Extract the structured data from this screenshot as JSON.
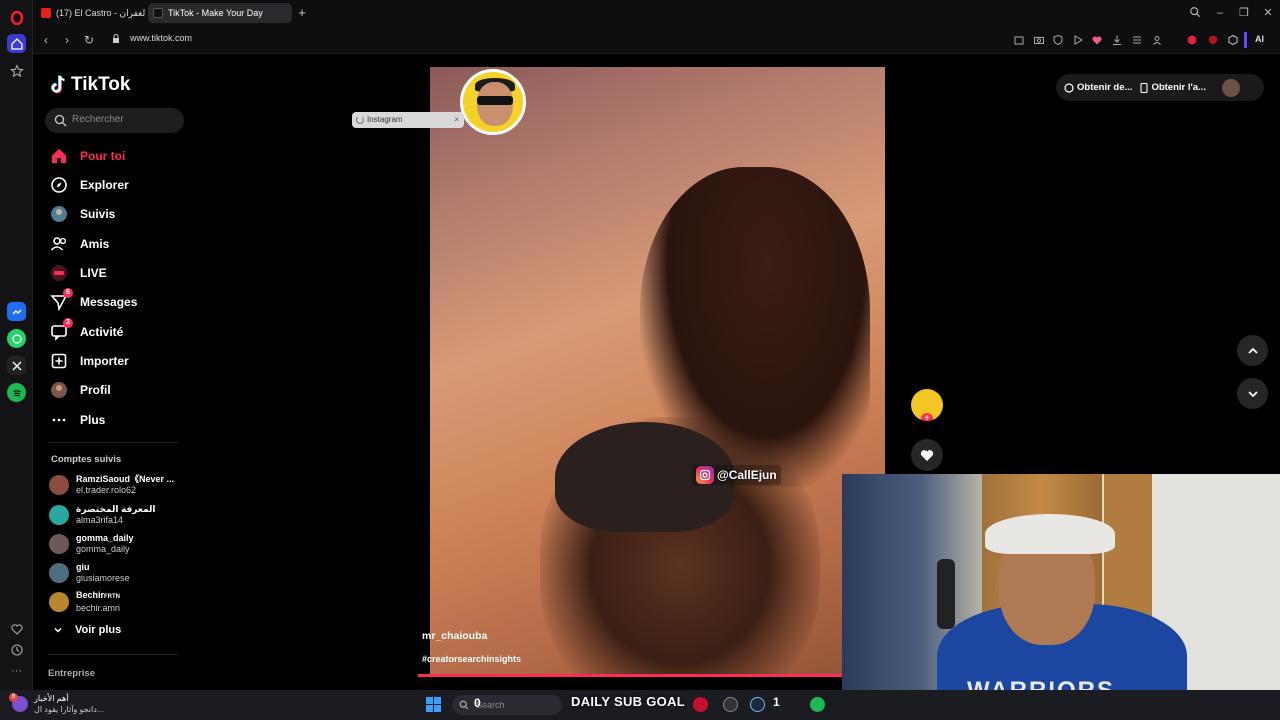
{
  "browser": {
    "tabs": [
      {
        "label": "(17) El Castro - الة الغفران",
        "active": false
      },
      {
        "label": "TikTok - Make Your Day",
        "active": true
      }
    ],
    "url": "www.tiktok.com",
    "ai_label": "AI"
  },
  "tiktok": {
    "logo": "TikTok",
    "search_placeholder": "Rechercher",
    "nav": [
      {
        "label": "Pour toi",
        "icon": "home-icon",
        "active": true
      },
      {
        "label": "Explorer",
        "icon": "compass-icon"
      },
      {
        "label": "Suivis",
        "icon": "following-avatar-icon"
      },
      {
        "label": "Amis",
        "icon": "friends-icon"
      },
      {
        "label": "LIVE",
        "icon": "live-icon"
      },
      {
        "label": "Messages",
        "icon": "messages-icon",
        "badge": "6"
      },
      {
        "label": "Activité",
        "icon": "activity-icon",
        "badge": "3"
      },
      {
        "label": "Importer",
        "icon": "upload-icon"
      },
      {
        "label": "Profil",
        "icon": "profile-avatar-icon"
      },
      {
        "label": "Plus",
        "icon": "more-icon"
      }
    ],
    "following_title": "Comptes suivis",
    "following": [
      {
        "name": "RamziSaoud《Never ...",
        "handle": "el.trader.rolo62",
        "color": "#8a4c3c"
      },
      {
        "name": "المعرفة المختصرة",
        "handle": "alma3rifa14",
        "color": "#2aa7a0"
      },
      {
        "name": "gomma_daily",
        "handle": "gomma_daily",
        "color": "#6d5a56"
      },
      {
        "name": "giu",
        "handle": "giusiamorese",
        "color": "#4d6e7c"
      },
      {
        "name": "Bechir",
        "name_suffix": "FRTN",
        "handle": "bechir.amri",
        "color": "#b8862f"
      }
    ],
    "see_more": "Voir plus",
    "footer": "Entreprise",
    "header_buttons": [
      {
        "label": "Obtenir de...",
        "icon": "coin-icon"
      },
      {
        "label": "Obtenir l'a...",
        "icon": "phone-icon"
      }
    ],
    "video": {
      "instagram_handle": "@CallEjun",
      "author": "mr_chaiouba",
      "hashtag": "#creatorsearchinsights",
      "progress": 0.95
    },
    "toast": "Instagram"
  },
  "taskbar": {
    "news_title": "أهم الأخبار",
    "news_sub": "دانجو وآثارا يقود ال...",
    "news_badge": "8",
    "search_placeholder": "Search",
    "count_left": "0",
    "sub_goal": "DAILY SUB GOAL",
    "count_right": "1"
  },
  "webcam": {
    "hoodie_text": "WARRIORS"
  }
}
